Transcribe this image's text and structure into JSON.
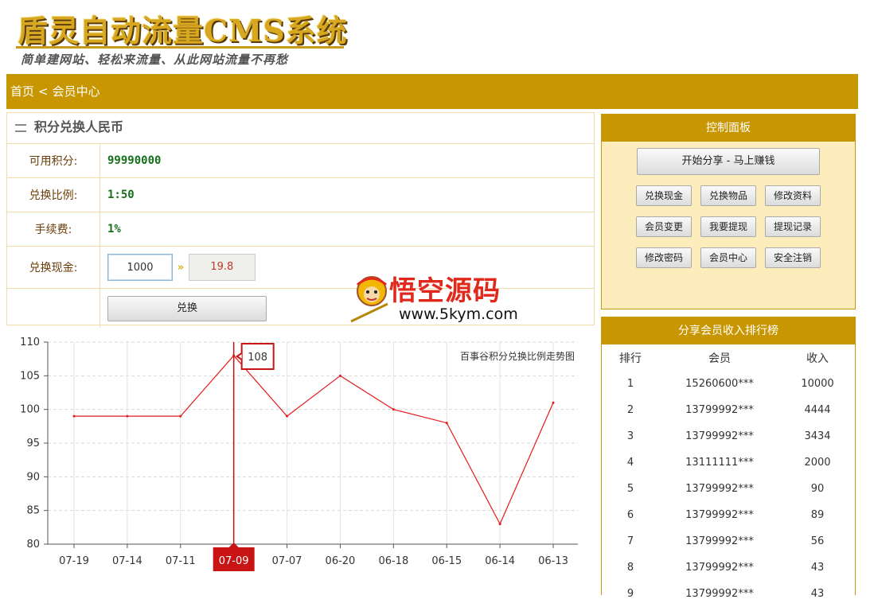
{
  "header": {
    "logo_title": "盾灵自动流量CMS系统",
    "logo_slogan": "简单建网站、轻松来流量、从此网站流量不再愁"
  },
  "breadcrumb": {
    "home": "首页",
    "separator": "<",
    "current": "会员中心"
  },
  "exchange": {
    "title": "积分兑换人民币",
    "points_label": "可用积分:",
    "points_value": "99990000",
    "ratio_label": "兑换比例:",
    "ratio_value": "1:50",
    "fee_label": "手续费:",
    "fee_value": "1%",
    "cash_label": "兑换现金:",
    "cash_input": "1000",
    "arrow": "»",
    "cash_result": "19.8",
    "submit": "兑换"
  },
  "chart_data": {
    "type": "line",
    "title": "百事谷积分兑换比例走势图",
    "categories": [
      "07-19",
      "07-14",
      "07-11",
      "07-09",
      "07-07",
      "06-20",
      "06-18",
      "06-15",
      "06-14",
      "06-13"
    ],
    "values": [
      99,
      99,
      99,
      108,
      99,
      105,
      100,
      98,
      83,
      101
    ],
    "ylim": [
      80,
      110
    ],
    "yticks": [
      80,
      85,
      90,
      95,
      100,
      105,
      110
    ],
    "highlight": {
      "category": "07-09",
      "value": 108
    },
    "line_color": "#e41a1c",
    "grid": true
  },
  "control_panel": {
    "title": "控制面板",
    "main_button": "开始分享 - 马上赚钱",
    "buttons": [
      "兑换现金",
      "兑换物品",
      "修改资料",
      "会员变更",
      "我要提现",
      "提现记录",
      "修改密码",
      "会员中心",
      "安全注销"
    ]
  },
  "ranking": {
    "title": "分享会员收入排行榜",
    "columns": [
      "排行",
      "会员",
      "收入"
    ],
    "rows": [
      [
        "1",
        "15260600***",
        "10000"
      ],
      [
        "2",
        "13799992***",
        "4444"
      ],
      [
        "3",
        "13799992***",
        "3434"
      ],
      [
        "4",
        "13111111***",
        "2000"
      ],
      [
        "5",
        "13799992***",
        "90"
      ],
      [
        "6",
        "13799992***",
        "89"
      ],
      [
        "7",
        "13799992***",
        "56"
      ],
      [
        "8",
        "13799992***",
        "43"
      ],
      [
        "9",
        "13799992***",
        "43"
      ]
    ]
  },
  "watermark": {
    "text_cn": "悟空源码",
    "text_url": "www.5kym.com"
  },
  "colors": {
    "accent": "#c79600",
    "panel_bg": "#fdedbc",
    "value_green": "#14701a",
    "chart_red": "#e41a1c"
  }
}
